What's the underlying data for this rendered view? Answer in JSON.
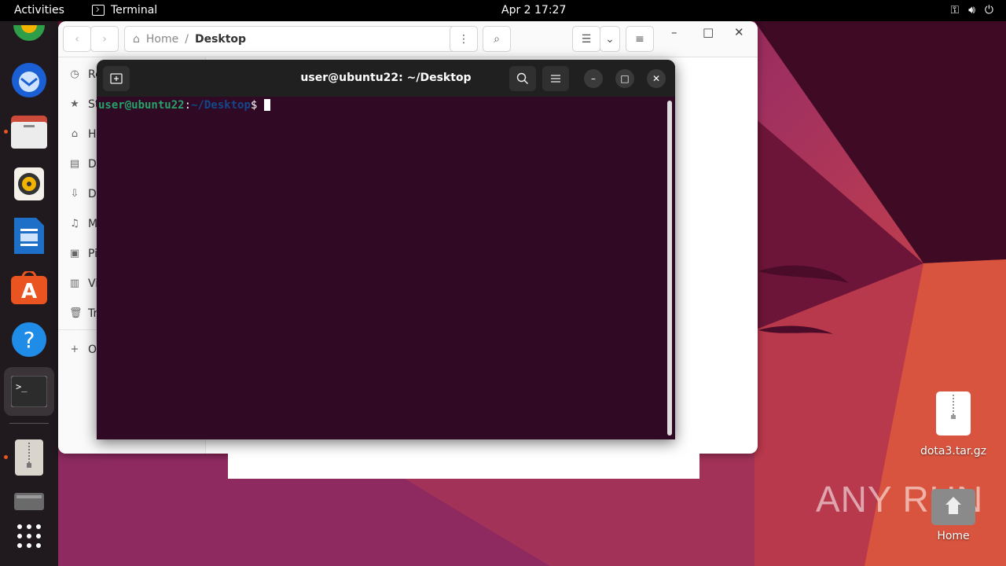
{
  "topbar": {
    "activities": "Activities",
    "app_name": "Terminal",
    "clock": "Apr 2  17:27"
  },
  "dock": {
    "apps": [
      "chrome",
      "thunderbird",
      "files",
      "rhythmbox",
      "writer",
      "app-center",
      "help",
      "terminal",
      "archive",
      "drive",
      "show-apps"
    ]
  },
  "files_window": {
    "breadcrumb_home": "Home",
    "breadcrumb_sep": "/",
    "breadcrumb_current": "Desktop",
    "sidebar": [
      "Re",
      "St",
      "Ho",
      "Do",
      "Do",
      "Mu",
      "Pi",
      "Vi",
      "Tr",
      "Ot"
    ]
  },
  "terminal": {
    "title": "user@ubuntu22: ~/Desktop",
    "prompt_user": "user@ubuntu22",
    "prompt_colon": ":",
    "prompt_path": "~/Desktop",
    "prompt_symbol": "$"
  },
  "desktop": {
    "file_label": "dota3.tar.gz",
    "home_label": "Home",
    "watermark": "ANY RUN"
  },
  "colors": {
    "terminal_bg": "#300a24",
    "accent": "#e95420"
  }
}
